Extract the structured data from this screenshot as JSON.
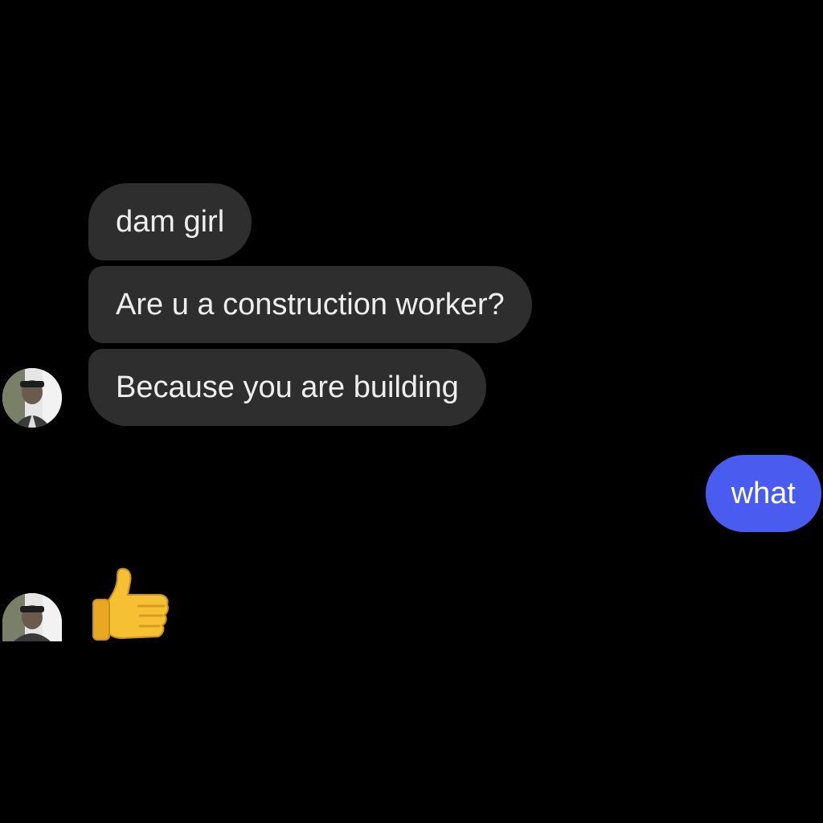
{
  "conversation": {
    "messages": [
      {
        "sender": "them",
        "text": "dam girl"
      },
      {
        "sender": "them",
        "text": "Are u a construction worker?"
      },
      {
        "sender": "them",
        "text": "Because you are building"
      },
      {
        "sender": "me",
        "text": "what"
      }
    ],
    "reply_reaction": {
      "sender": "them",
      "icon": "thumbs-up-icon"
    }
  },
  "theme": {
    "background": "#000000",
    "incoming_bubble": "#2e2e2e",
    "outgoing_bubble": "#4a5cf0",
    "text": "#eeeeee",
    "emoji_yellow": "#f5c033"
  }
}
